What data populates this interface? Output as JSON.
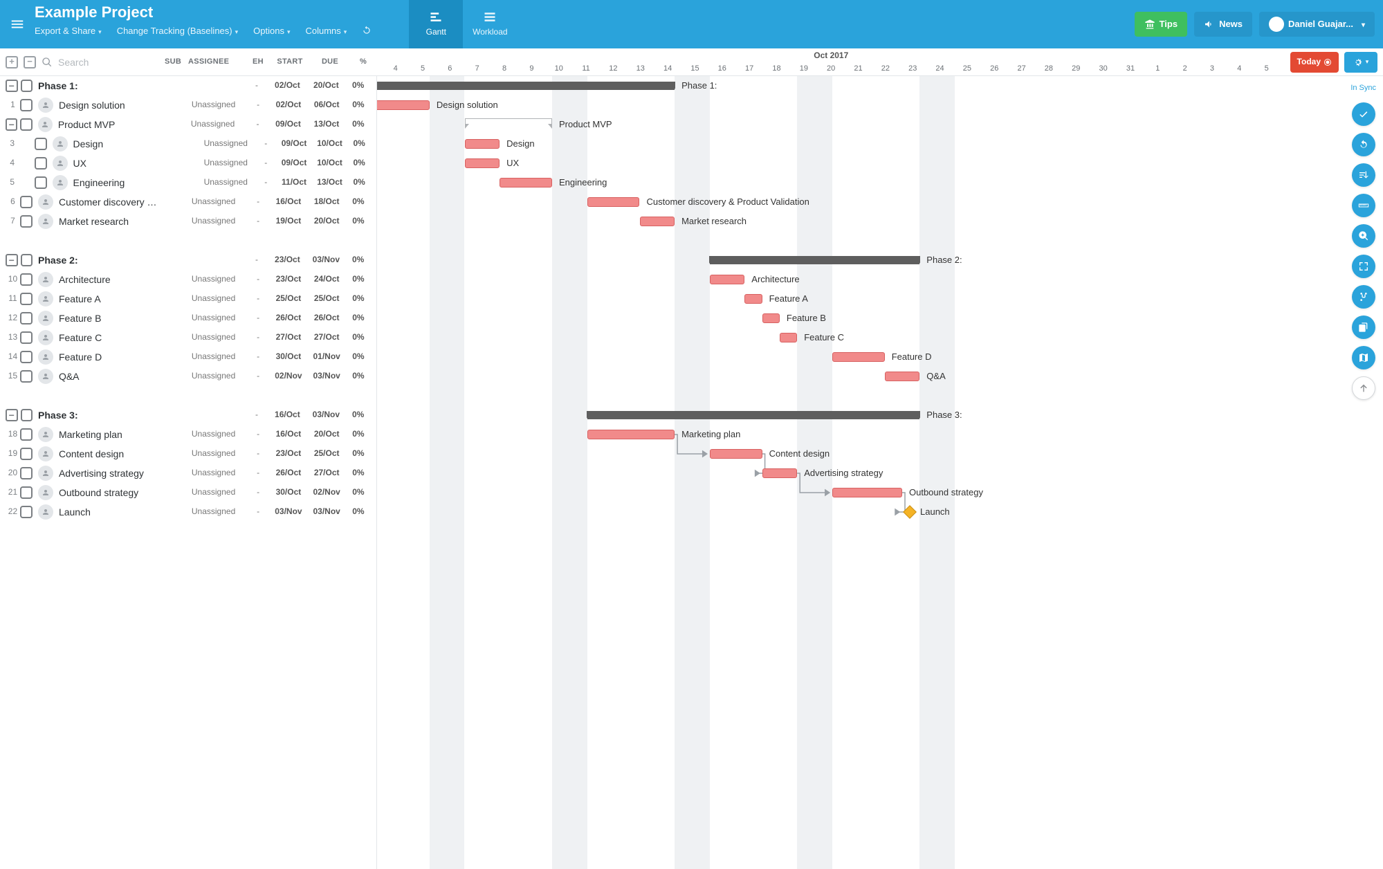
{
  "header": {
    "title": "Example Project",
    "menu": [
      "Export & Share",
      "Change Tracking (Baselines)",
      "Options",
      "Columns"
    ],
    "modes": {
      "gantt": "Gantt",
      "workload": "Workload"
    },
    "tips": "Tips",
    "news": "News",
    "user": "Daniel Guajar..."
  },
  "subheader": {
    "search_placeholder": "Search",
    "cols": [
      "SUB",
      "ASSIGNEE",
      "EH",
      "START",
      "DUE",
      "%"
    ],
    "month": "Oct 2017",
    "today": "Today"
  },
  "sync_label": "In Sync",
  "timeline": {
    "origin_day": 4,
    "days": [
      "4",
      "5",
      "6",
      "7",
      "8",
      "9",
      "10",
      "11",
      "12",
      "13",
      "14",
      "15",
      "16",
      "17",
      "18",
      "19",
      "20",
      "21",
      "22",
      "23",
      "24",
      "25",
      "26",
      "27",
      "28",
      "29",
      "30",
      "31",
      "1",
      "2",
      "3",
      "4",
      "5"
    ],
    "dayW": 25.3,
    "weekends": [
      [
        7,
        8
      ],
      [
        14,
        15
      ],
      [
        21,
        22
      ],
      [
        28,
        29
      ],
      [
        35,
        36
      ]
    ]
  },
  "phases": [
    {
      "kind": "phase",
      "label": "Phase 1:",
      "start": "02/Oct",
      "due": "20/Oct",
      "pct": "0%",
      "s": 2,
      "e": 20
    },
    {
      "kind": "task",
      "n": "1",
      "label": "Design solution",
      "asg": "Unassigned",
      "start": "02/Oct",
      "due": "06/Oct",
      "pct": "0%",
      "s": 2,
      "e": 6
    },
    {
      "kind": "parent",
      "n": "",
      "label": "Product MVP",
      "asg": "Unassigned",
      "start": "09/Oct",
      "due": "13/Oct",
      "pct": "0%",
      "s": 9,
      "e": 13
    },
    {
      "kind": "sub",
      "n": "3",
      "label": "Design",
      "asg": "Unassigned",
      "start": "09/Oct",
      "due": "10/Oct",
      "pct": "0%",
      "s": 9,
      "e": 10
    },
    {
      "kind": "sub",
      "n": "4",
      "label": "UX",
      "asg": "Unassigned",
      "start": "09/Oct",
      "due": "10/Oct",
      "pct": "0%",
      "s": 9,
      "e": 10
    },
    {
      "kind": "sub",
      "n": "5",
      "label": "Engineering",
      "asg": "Unassigned",
      "start": "11/Oct",
      "due": "13/Oct",
      "pct": "0%",
      "s": 11,
      "e": 13
    },
    {
      "kind": "task",
      "n": "6",
      "label": "Customer discovery & ...",
      "glabel": "Customer discovery & Product Validation",
      "asg": "Unassigned",
      "start": "16/Oct",
      "due": "18/Oct",
      "pct": "0%",
      "s": 16,
      "e": 18
    },
    {
      "kind": "task",
      "n": "7",
      "label": "Market research",
      "asg": "Unassigned",
      "start": "19/Oct",
      "due": "20/Oct",
      "pct": "0%",
      "s": 19,
      "e": 20
    },
    {
      "kind": "gap"
    },
    {
      "kind": "phase",
      "label": "Phase 2:",
      "start": "23/Oct",
      "due": "03/Nov",
      "pct": "0%",
      "s": 23,
      "e": 34
    },
    {
      "kind": "task",
      "n": "10",
      "label": "Architecture",
      "asg": "Unassigned",
      "start": "23/Oct",
      "due": "24/Oct",
      "pct": "0%",
      "s": 23,
      "e": 24
    },
    {
      "kind": "task",
      "n": "11",
      "label": "Feature A",
      "asg": "Unassigned",
      "start": "25/Oct",
      "due": "25/Oct",
      "pct": "0%",
      "s": 25,
      "e": 25
    },
    {
      "kind": "task",
      "n": "12",
      "label": "Feature B",
      "asg": "Unassigned",
      "start": "26/Oct",
      "due": "26/Oct",
      "pct": "0%",
      "s": 26,
      "e": 26
    },
    {
      "kind": "task",
      "n": "13",
      "label": "Feature C",
      "asg": "Unassigned",
      "start": "27/Oct",
      "due": "27/Oct",
      "pct": "0%",
      "s": 27,
      "e": 27
    },
    {
      "kind": "task",
      "n": "14",
      "label": "Feature D",
      "asg": "Unassigned",
      "start": "30/Oct",
      "due": "01/Nov",
      "pct": "0%",
      "s": 30,
      "e": 32
    },
    {
      "kind": "task",
      "n": "15",
      "label": "Q&A",
      "asg": "Unassigned",
      "start": "02/Nov",
      "due": "03/Nov",
      "pct": "0%",
      "s": 33,
      "e": 34
    },
    {
      "kind": "gap"
    },
    {
      "kind": "phase",
      "label": "Phase 3:",
      "start": "16/Oct",
      "due": "03/Nov",
      "pct": "0%",
      "s": 16,
      "e": 34
    },
    {
      "kind": "task",
      "n": "18",
      "label": "Marketing plan",
      "asg": "Unassigned",
      "start": "16/Oct",
      "due": "20/Oct",
      "pct": "0%",
      "s": 16,
      "e": 20,
      "link": 19
    },
    {
      "kind": "task",
      "n": "19",
      "label": "Content design",
      "asg": "Unassigned",
      "start": "23/Oct",
      "due": "25/Oct",
      "pct": "0%",
      "s": 23,
      "e": 25,
      "link": 20
    },
    {
      "kind": "task",
      "n": "20",
      "label": "Advertising strategy",
      "asg": "Unassigned",
      "start": "26/Oct",
      "due": "27/Oct",
      "pct": "0%",
      "s": 26,
      "e": 27,
      "link": 21
    },
    {
      "kind": "task",
      "n": "21",
      "label": "Outbound strategy",
      "asg": "Unassigned",
      "start": "30/Oct",
      "due": "02/Nov",
      "pct": "0%",
      "s": 30,
      "e": 33,
      "link": 22
    },
    {
      "kind": "ms",
      "n": "22",
      "label": "Launch",
      "asg": "Unassigned",
      "start": "03/Nov",
      "due": "03/Nov",
      "pct": "0%",
      "s": 34
    }
  ],
  "rail_icons": [
    "check-icon",
    "undo-icon",
    "sort-icon",
    "ruler-icon",
    "zoom-icon",
    "frame-icon",
    "branch-icon",
    "copy-icon",
    "map-icon",
    "up-icon"
  ]
}
